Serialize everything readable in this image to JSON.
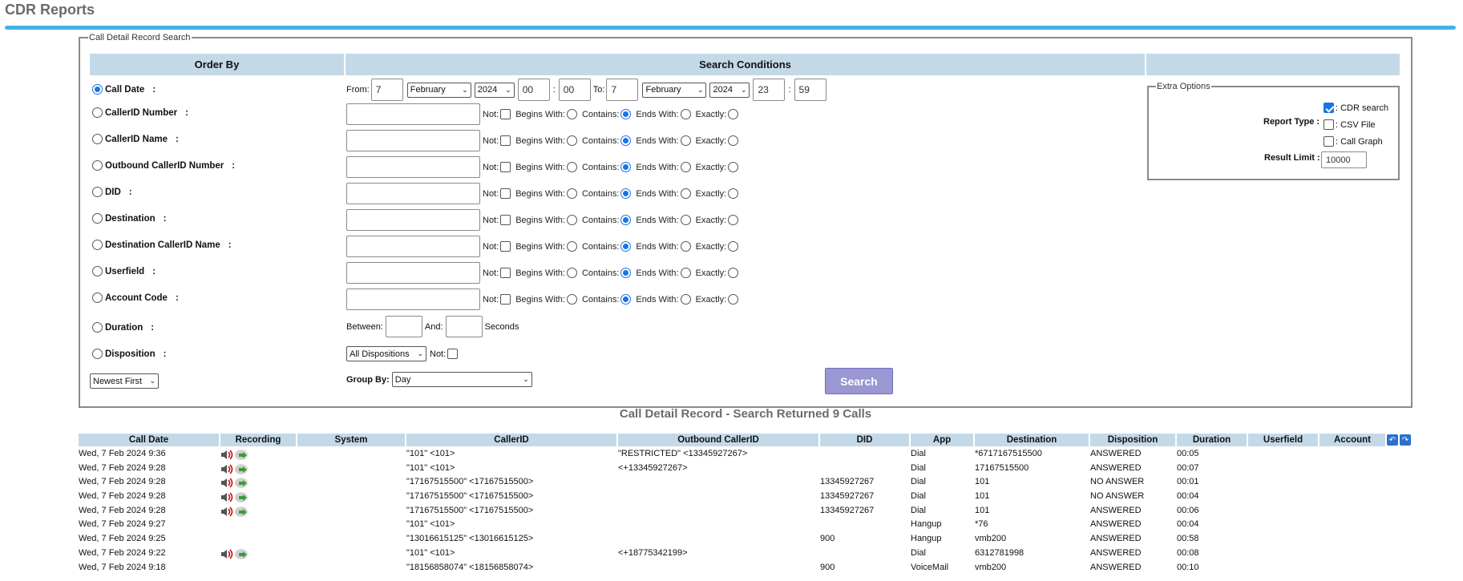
{
  "page": {
    "title": "CDR Reports"
  },
  "search": {
    "legend": "Call Detail Record Search",
    "order_by_header": "Order By",
    "conditions_header": "Search Conditions",
    "date": {
      "label": "Call Date",
      "from_label": "From:",
      "to_label": "To:",
      "from_day": "7",
      "from_month": "February",
      "from_year": "2024",
      "from_hour": "00",
      "from_minute": "00",
      "to_day": "7",
      "to_month": "February",
      "to_year": "2024",
      "to_hour": "23",
      "to_minute": "59"
    },
    "match_labels": {
      "not": "Not:",
      "begins": "Begins With:",
      "contains": "Contains:",
      "ends": "Ends With:",
      "exactly": "Exactly:"
    },
    "fields": [
      {
        "label": "CallerID Number"
      },
      {
        "label": "CallerID Name"
      },
      {
        "label": "Outbound CallerID Number"
      },
      {
        "label": "DID"
      },
      {
        "label": "Destination"
      },
      {
        "label": "Destination CallerID Name"
      },
      {
        "label": "Userfield"
      },
      {
        "label": "Account Code"
      }
    ],
    "duration": {
      "label": "Duration",
      "between": "Between:",
      "and": "And:",
      "unit": "Seconds"
    },
    "disposition": {
      "label": "Disposition",
      "selected": "All Dispositions",
      "not": "Not:"
    },
    "sort_order": "Newest First",
    "group_by": {
      "label": "Group By:",
      "selected": "Day"
    },
    "search_button": "Search",
    "colon": ":"
  },
  "extra": {
    "legend": "Extra Options",
    "report_type_label": "Report Type :",
    "cdr_search": ": CDR search",
    "csv_file": ": CSV File",
    "call_graph": ": Call Graph",
    "result_limit_label": "Result Limit :",
    "result_limit": "10000"
  },
  "results": {
    "title": "Call Detail Record - Search Returned 9 Calls",
    "columns": [
      "Call Date",
      "Recording",
      "System",
      "CallerID",
      "Outbound CallerID",
      "DID",
      "App",
      "Destination",
      "Disposition",
      "Duration",
      "Userfield",
      "Account"
    ],
    "rows": [
      {
        "date": "Wed, 7 Feb 2024 9:36",
        "rec": true,
        "system": "",
        "callerid": "\"101\" <101>",
        "outbound": "\"RESTRICTED\" <13345927267>",
        "did": "",
        "app": "Dial",
        "dest": "*6717167515500",
        "disp": "ANSWERED",
        "dur": "00:05"
      },
      {
        "date": "Wed, 7 Feb 2024 9:28",
        "rec": true,
        "system": "",
        "callerid": "\"101\" <101>",
        "outbound": "<+13345927267>",
        "did": "",
        "app": "Dial",
        "dest": "17167515500",
        "disp": "ANSWERED",
        "dur": "00:07"
      },
      {
        "date": "Wed, 7 Feb 2024 9:28",
        "rec": true,
        "system": "",
        "callerid": "\"17167515500\" <17167515500>",
        "outbound": "",
        "did": "13345927267",
        "app": "Dial",
        "dest": "101",
        "disp": "NO ANSWER",
        "dur": "00:01"
      },
      {
        "date": "Wed, 7 Feb 2024 9:28",
        "rec": true,
        "system": "",
        "callerid": "\"17167515500\" <17167515500>",
        "outbound": "",
        "did": "13345927267",
        "app": "Dial",
        "dest": "101",
        "disp": "NO ANSWER",
        "dur": "00:04"
      },
      {
        "date": "Wed, 7 Feb 2024 9:28",
        "rec": true,
        "system": "",
        "callerid": "\"17167515500\" <17167515500>",
        "outbound": "",
        "did": "13345927267",
        "app": "Dial",
        "dest": "101",
        "disp": "ANSWERED",
        "dur": "00:06"
      },
      {
        "date": "Wed, 7 Feb 2024 9:27",
        "rec": false,
        "system": "",
        "callerid": "\"101\" <101>",
        "outbound": "",
        "did": "",
        "app": "Hangup",
        "dest": "*76",
        "disp": "ANSWERED",
        "dur": "00:04"
      },
      {
        "date": "Wed, 7 Feb 2024 9:25",
        "rec": false,
        "system": "",
        "callerid": "\"13016615125\" <13016615125>",
        "outbound": "",
        "did": "900",
        "app": "Hangup",
        "dest": "vmb200",
        "disp": "ANSWERED",
        "dur": "00:58"
      },
      {
        "date": "Wed, 7 Feb 2024 9:22",
        "rec": true,
        "system": "",
        "callerid": "\"101\" <101>",
        "outbound": "<+18775342199>",
        "did": "",
        "app": "Dial",
        "dest": "6312781998",
        "disp": "ANSWERED",
        "dur": "00:08"
      },
      {
        "date": "Wed, 7 Feb 2024 9:18",
        "rec": false,
        "system": "",
        "callerid": "\"18156858074\" <18156858074>",
        "outbound": "",
        "did": "900",
        "app": "VoiceMail",
        "dest": "vmb200",
        "disp": "ANSWERED",
        "dur": "00:10"
      }
    ]
  },
  "icons": {
    "speaker": "speaker-icon",
    "download": "download-icon",
    "sort_up": "sort-ascending-icon",
    "sort_down": "sort-descending-icon"
  },
  "colors": {
    "accent_rule": "#45b2e2",
    "header_bg": "#c3d9e7",
    "search_button": "#9a97d2",
    "radio_checked": "#1a73e8"
  }
}
